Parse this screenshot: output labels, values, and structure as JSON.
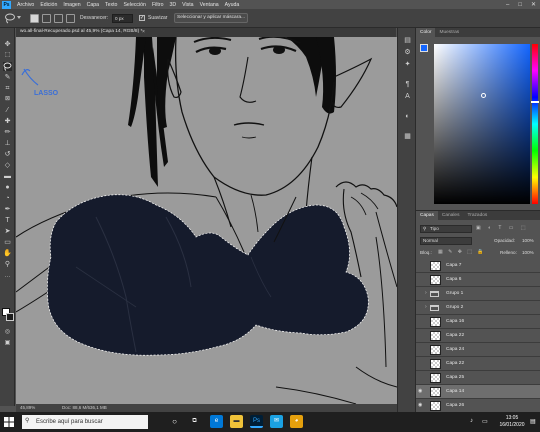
{
  "menubar": {
    "logo": "Ps",
    "items": [
      "Archivo",
      "Edición",
      "Imagen",
      "Capa",
      "Texto",
      "Selección",
      "Filtro",
      "3D",
      "Vista",
      "Ventana",
      "Ayuda"
    ]
  },
  "options": {
    "difuminar_label": "Desvanecer:",
    "difuminar_value": "0 px",
    "suavizar_label": "Suavizar",
    "select_mask_label": "Seleccionar y aplicar máscara..."
  },
  "document": {
    "tab_title": "wo.all-final-Recuperado.psd al 45,9% (Capa 14, RGB/8) *",
    "zoom": "45,89%",
    "doc_info": "Doc: 88,6 M/636,1 MB",
    "annotation": "LASSO"
  },
  "color_panel": {
    "tabs": [
      "Color",
      "Muestras"
    ],
    "hue_hex": "#1466ff"
  },
  "layers_panel": {
    "tabs": [
      "Capas",
      "Canales",
      "Trazados"
    ],
    "filter_label": "Tipo",
    "blend_mode": "Normal",
    "opacity_label": "Opacidad:",
    "opacity_value": "100%",
    "lock_label": "Bloq.:",
    "fill_label": "Relleno:",
    "fill_value": "100%",
    "layers": [
      {
        "name": "Capa 7",
        "kind": "layer",
        "visible": false,
        "selected": false
      },
      {
        "name": "Capa 6",
        "kind": "layer",
        "visible": false,
        "selected": false
      },
      {
        "name": "Grupo 1",
        "kind": "group",
        "visible": false,
        "selected": false
      },
      {
        "name": "Grupo 2",
        "kind": "group",
        "visible": false,
        "selected": false
      },
      {
        "name": "Capa 16",
        "kind": "layer",
        "visible": false,
        "selected": false
      },
      {
        "name": "Capa 22",
        "kind": "layer",
        "visible": false,
        "selected": false
      },
      {
        "name": "Capa 24",
        "kind": "layer",
        "visible": false,
        "selected": false
      },
      {
        "name": "Capa 22",
        "kind": "layer",
        "visible": false,
        "selected": false
      },
      {
        "name": "Capa 25",
        "kind": "layer",
        "visible": false,
        "selected": false
      },
      {
        "name": "Capa 14",
        "kind": "layer",
        "visible": true,
        "selected": true
      },
      {
        "name": "Capa 26",
        "kind": "layer",
        "visible": true,
        "selected": false
      }
    ]
  },
  "taskbar": {
    "search_placeholder": "Escribe aquí para buscar",
    "time": "13:05",
    "date": "16/01/2020"
  },
  "colors": {
    "selection_fill": "#151b2c",
    "canvas_bg": "#9b9b9b",
    "annotation": "#3a6fd8"
  }
}
